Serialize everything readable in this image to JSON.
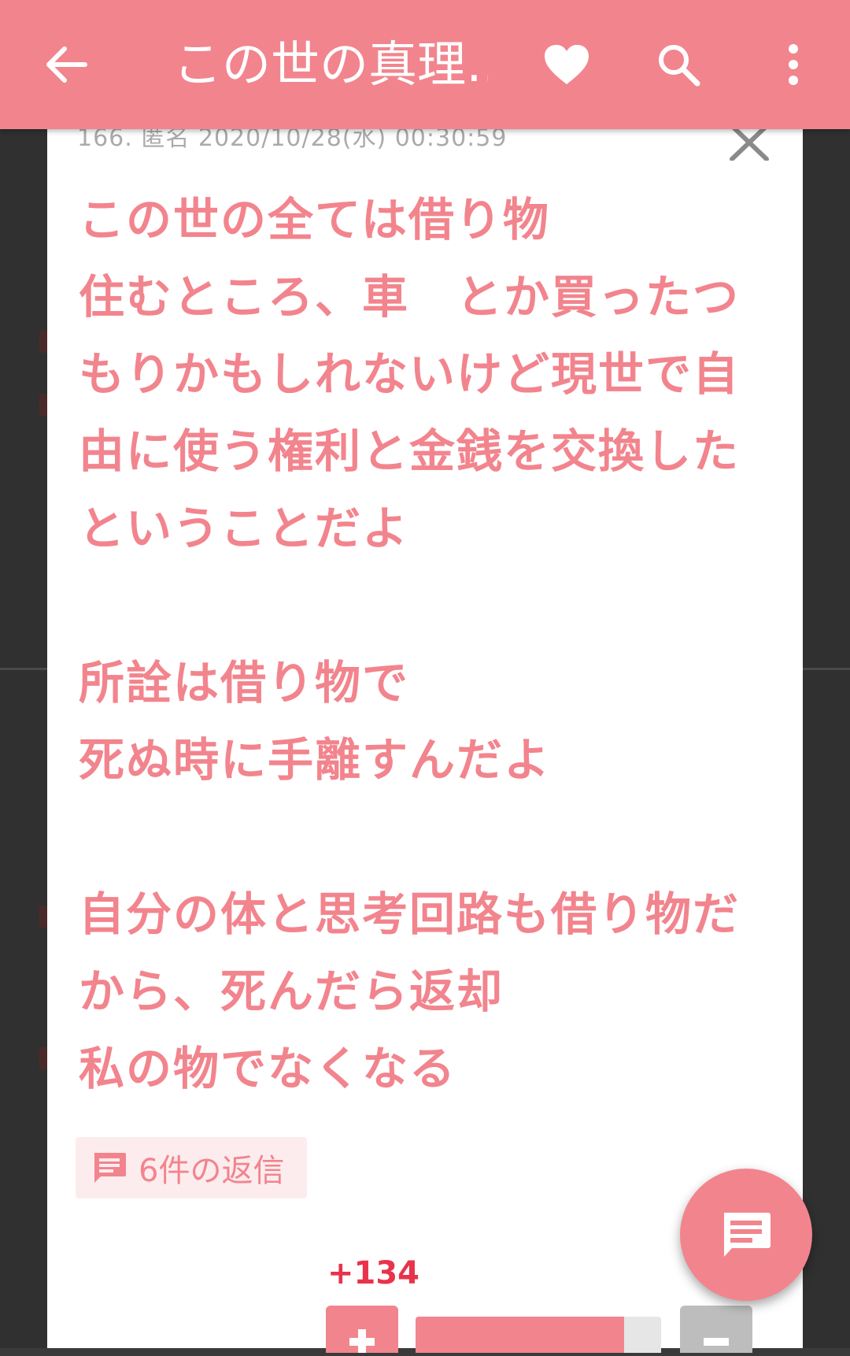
{
  "app_bar": {
    "title": "この世の真理…",
    "icons": {
      "back": "arrow-left-icon",
      "favorite": "heart-icon",
      "search": "search-icon",
      "more": "more-vertical-icon"
    }
  },
  "comment": {
    "meta": "166. 匿名  2020/10/28(水)  00:30:59",
    "lines": [
      "この世の全ては借り物",
      "住むところ、車　とか買ったつ",
      "もりかもしれないけど現世で自",
      "由に使う権利と金銭を交換した",
      "ということだよ",
      "",
      "所詮は借り物で",
      "死ぬ時に手離すんだよ",
      "",
      "自分の体と思考回路も借り物だ",
      "から、死んだら返却",
      "私の物でなくなる"
    ],
    "reply_label": "6件の返信",
    "score": "+134",
    "vote_ratio": 0.85
  },
  "colors": {
    "accent": "#f2848d",
    "score": "#e8334b",
    "chip_bg": "#fdecee",
    "backdrop": "#3a3a3a"
  }
}
